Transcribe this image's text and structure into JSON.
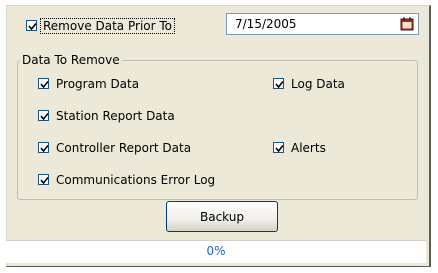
{
  "remove_prior": {
    "label": "Remove Data Prior To",
    "checked": true
  },
  "date": {
    "value": "7/15/2005"
  },
  "group": {
    "title": "Data To Remove",
    "items": [
      {
        "label": "Program Data",
        "checked": true
      },
      {
        "label": "Log Data",
        "checked": true
      },
      {
        "label": "Station Report Data",
        "checked": true
      },
      {
        "label": "Controller Report Data",
        "checked": true
      },
      {
        "label": "Alerts",
        "checked": true
      },
      {
        "label": "Communications Error Log",
        "checked": true
      }
    ]
  },
  "backup_button": {
    "label": "Backup"
  },
  "progress": {
    "value": 0,
    "text": "0%"
  },
  "colors": {
    "panel": "#ece9d8",
    "progress_text": "#2060d0",
    "check_border": "#1c5180"
  }
}
